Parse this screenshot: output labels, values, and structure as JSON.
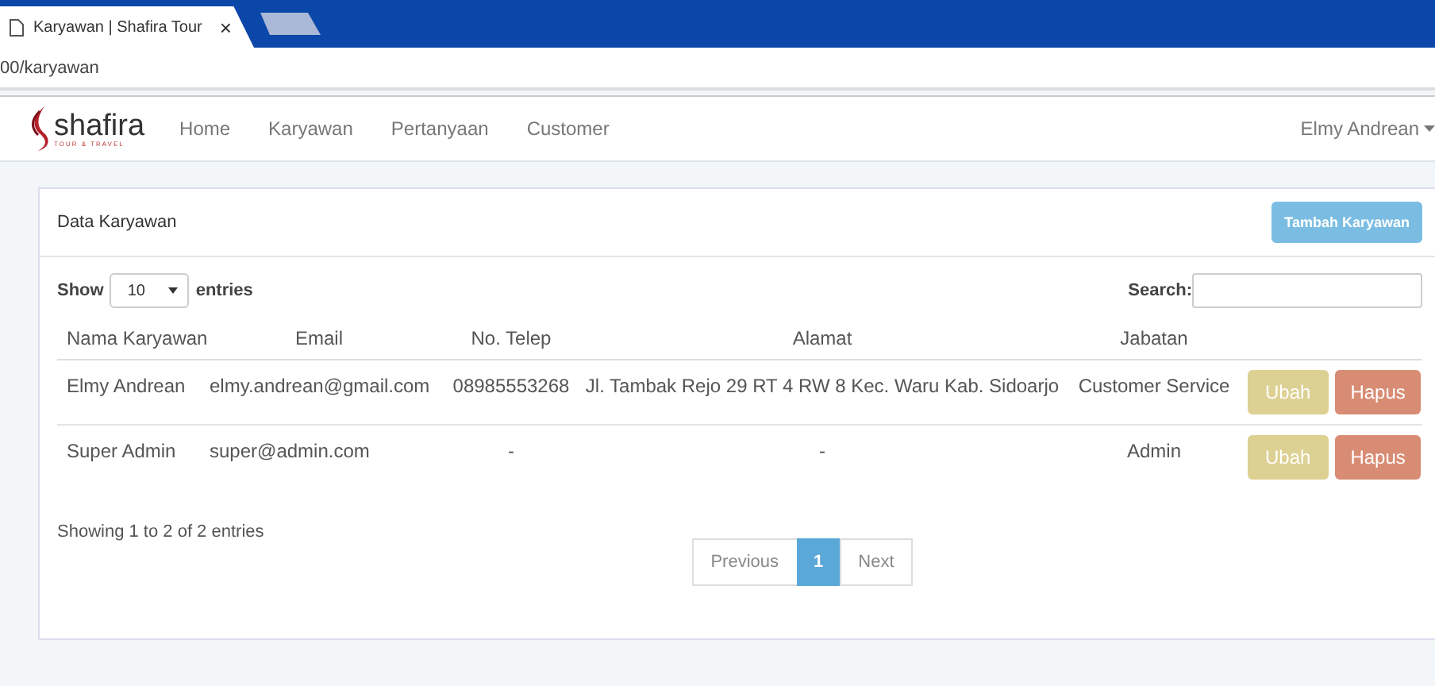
{
  "browser": {
    "tabs": [
      {
        "title": "Karyawan | Shafira Tour",
        "selected": true,
        "close": "×"
      }
    ],
    "address": "00/karyawan"
  },
  "navbar": {
    "brand": {
      "name": "shafira",
      "tagline": "TOUR & TRAVEL"
    },
    "items": [
      {
        "label": "Home",
        "selected": false
      },
      {
        "label": "Karyawan",
        "selected": false
      },
      {
        "label": "Pertanyaan",
        "selected": false
      },
      {
        "label": "Customer",
        "selected": false
      }
    ],
    "user": "Elmy Andrean"
  },
  "panel": {
    "title": "Data Karyawan",
    "add_button": "Tambah Karyawan",
    "length": {
      "before": "Show",
      "value": "10",
      "after": "entries"
    },
    "search": {
      "label": "Search:"
    },
    "table": {
      "columns": [
        "Nama Karyawan",
        "Email",
        "No. Telep",
        "Alamat",
        "Jabatan"
      ],
      "rows": [
        {
          "cells": [
            "Elmy Andrean",
            "elmy.andrean@gmail.com",
            "08985553268",
            "Jl. Tambak Rejo 29 RT 4 RW 8 Kec. Waru Kab. Sidoarjo",
            "Customer Service"
          ],
          "actions": [
            "Ubah",
            "Hapus"
          ]
        },
        {
          "cells": [
            "Super Admin",
            "super@admin.com",
            "-",
            "-",
            "Admin"
          ],
          "actions": [
            "Ubah",
            "Hapus"
          ]
        }
      ]
    },
    "info": "Showing 1 to 2 of 2 entries",
    "pagination": [
      {
        "label": "Previous",
        "kind": "nav",
        "selected": false
      },
      {
        "label": "1",
        "kind": "page",
        "selected": true
      },
      {
        "label": "Next",
        "kind": "nav",
        "selected": false
      }
    ]
  }
}
